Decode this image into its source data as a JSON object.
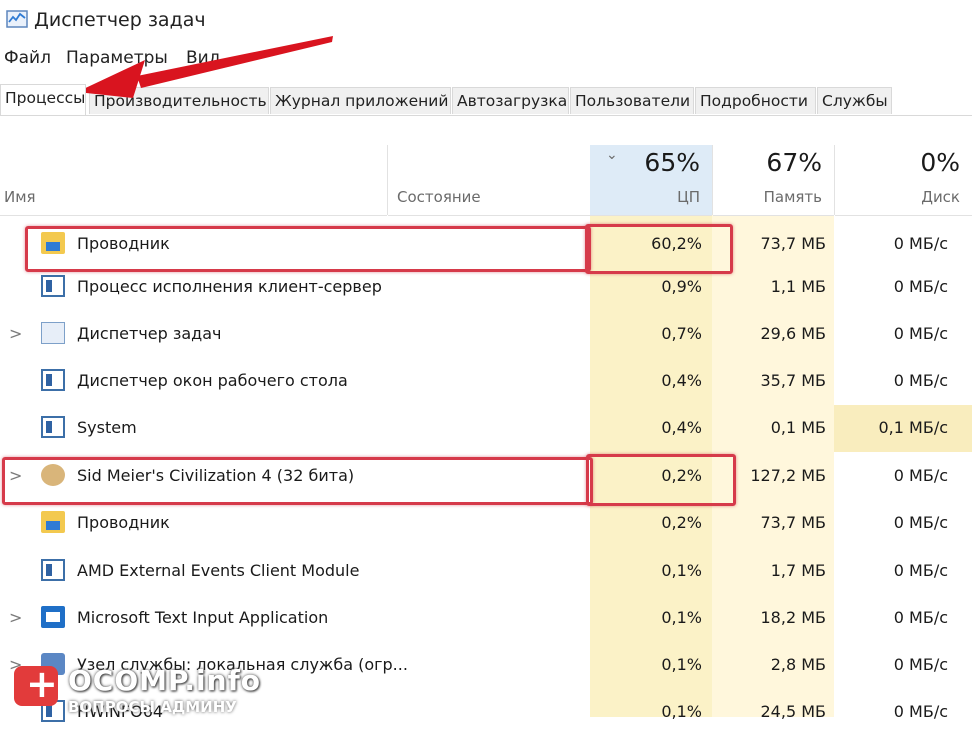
{
  "window": {
    "title": "Диспетчер задач"
  },
  "menu": [
    "Файл",
    "Параметры",
    "Вид"
  ],
  "tabs": [
    "Процессы",
    "Производительность",
    "Журнал приложений",
    "Автозагрузка",
    "Пользователи",
    "Подробности",
    "Службы"
  ],
  "columns": {
    "name": "Имя",
    "status": "Состояние",
    "cpu": {
      "percent": "65%",
      "label": "ЦП"
    },
    "memory": {
      "percent": "67%",
      "label": "Память"
    },
    "disk": {
      "percent": "0%",
      "label": "Диск"
    }
  },
  "rows": [
    {
      "name": "Проводник",
      "cpu": "60,2%",
      "mem": "73,7 МБ",
      "disk": "0 МБ/с",
      "icon": "folder-icon",
      "expand": ""
    },
    {
      "name": "Процесс исполнения клиент-сервер",
      "cpu": "0,9%",
      "mem": "1,1 МБ",
      "disk": "0 МБ/с",
      "icon": "window-icon",
      "expand": ""
    },
    {
      "name": "Диспетчер задач",
      "cpu": "0,7%",
      "mem": "29,6 МБ",
      "disk": "0 МБ/с",
      "icon": "task-manager-icon",
      "expand": ">"
    },
    {
      "name": "Диспетчер окон рабочего стола",
      "cpu": "0,4%",
      "mem": "35,7 МБ",
      "disk": "0 МБ/с",
      "icon": "window-icon",
      "expand": ""
    },
    {
      "name": "System",
      "cpu": "0,4%",
      "mem": "0,1 МБ",
      "disk": "0,1 МБ/с",
      "icon": "window-icon",
      "expand": ""
    },
    {
      "name": "Sid Meier's Civilization 4 (32 бита)",
      "cpu": "0,2%",
      "mem": "127,2 МБ",
      "disk": "0 МБ/с",
      "icon": "civilization-icon",
      "expand": ">"
    },
    {
      "name": "Проводник",
      "cpu": "0,2%",
      "mem": "73,7 МБ",
      "disk": "0 МБ/с",
      "icon": "folder-icon",
      "expand": ""
    },
    {
      "name": "AMD External Events Client Module",
      "cpu": "0,1%",
      "mem": "1,7 МБ",
      "disk": "0 МБ/с",
      "icon": "window-icon",
      "expand": ""
    },
    {
      "name": "Microsoft Text Input Application",
      "cpu": "0,1%",
      "mem": "18,2 МБ",
      "disk": "0 МБ/с",
      "icon": "app-icon",
      "expand": ">"
    },
    {
      "name": "Узел службы: локальная служба (огр...",
      "cpu": "0,1%",
      "mem": "2,8 МБ",
      "disk": "0 МБ/с",
      "icon": "gear-icon",
      "expand": ">"
    },
    {
      "name": "HWiNFO64",
      "cpu": "0,1%",
      "mem": "24,5 МБ",
      "disk": "0 МБ/с",
      "icon": "window-icon",
      "expand": ""
    }
  ],
  "watermark": {
    "title": "OCOMP.info",
    "subtitle": "ВОПРОСЫ АДМИНУ"
  },
  "colors": {
    "highlight": "#d63a4a",
    "cpu_bg": "#fbf2c7",
    "arrow": "#d9141f"
  }
}
